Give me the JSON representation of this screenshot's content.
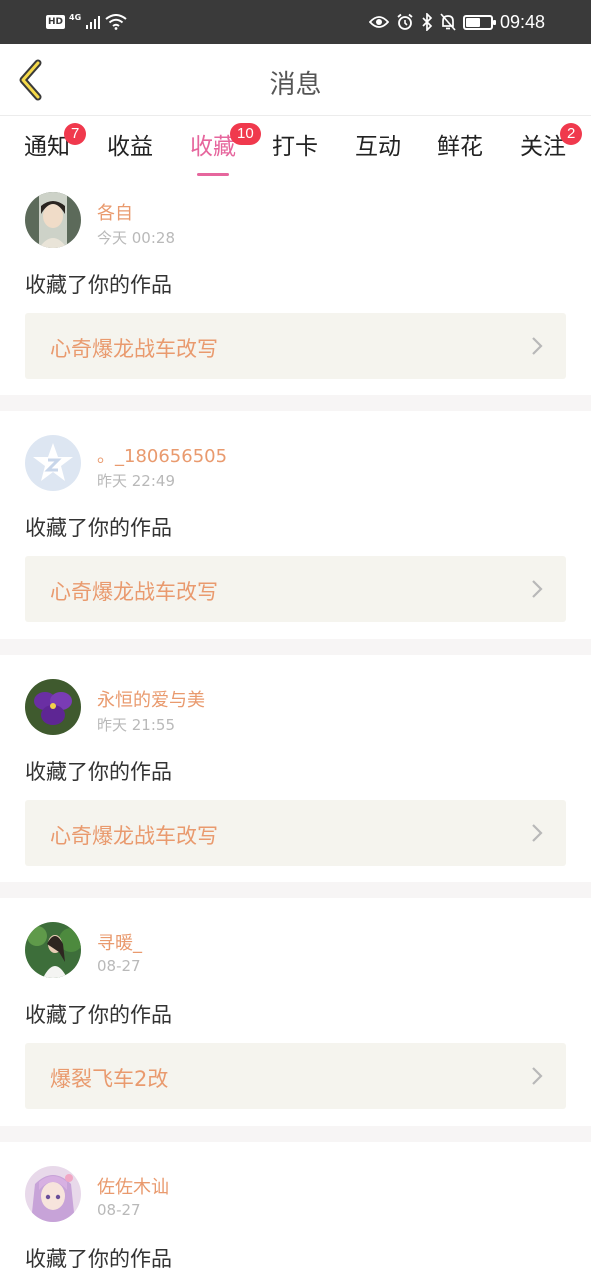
{
  "status_bar": {
    "hd": "HD",
    "network": "4G",
    "time": "09:48",
    "battery_level": 0.6,
    "icons": [
      "signal-icon",
      "wifi-icon",
      "eye-icon",
      "alarm-icon",
      "bluetooth-icon",
      "mute-bell-icon",
      "battery-icon"
    ]
  },
  "header": {
    "title": "消息",
    "back_icon": "chevron-left-icon"
  },
  "tabs": [
    {
      "label": "通知",
      "badge": "7",
      "active": false
    },
    {
      "label": "收益",
      "badge": "",
      "active": false
    },
    {
      "label": "收藏",
      "badge": "10",
      "active": true
    },
    {
      "label": "打卡",
      "badge": "",
      "active": false
    },
    {
      "label": "互动",
      "badge": "",
      "active": false
    },
    {
      "label": "鲜花",
      "badge": "",
      "active": false
    },
    {
      "label": "关注",
      "badge": "2",
      "active": false
    }
  ],
  "colors": {
    "accent": "#e6669d",
    "username": "#e99a6e",
    "badge": "#f0394d",
    "card_link_bg": "#f5f4ee"
  },
  "messages": [
    {
      "username": "各自",
      "time": "今天 00:28",
      "action": "收藏了你的作品",
      "work_title": "心奇爆龙战车改写",
      "avatar_icon": "user-photo-avatar"
    },
    {
      "username": "。_180656505",
      "time": "昨天 22:49",
      "action": "收藏了你的作品",
      "work_title": "心奇爆龙战车改写",
      "avatar_icon": "default-star-avatar"
    },
    {
      "username": "永恒的爱与美",
      "time": "昨天 21:55",
      "action": "收藏了你的作品",
      "work_title": "心奇爆龙战车改写",
      "avatar_icon": "violet-flower-avatar"
    },
    {
      "username": "寻暖_",
      "time": "08-27",
      "action": "收藏了你的作品",
      "work_title": "爆裂飞车2改",
      "avatar_icon": "user-photo-avatar"
    },
    {
      "username": "佐佐木讪",
      "time": "08-27",
      "action": "收藏了你的作品",
      "work_title": "",
      "avatar_icon": "anime-avatar"
    }
  ]
}
